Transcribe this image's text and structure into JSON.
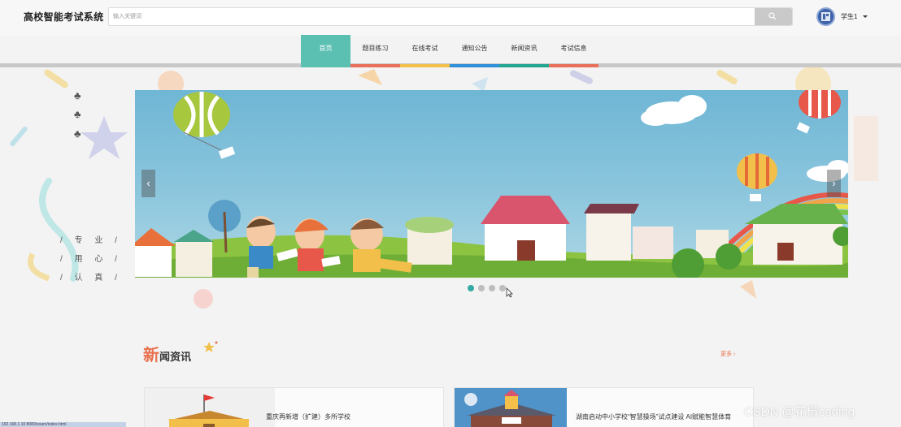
{
  "app": {
    "title": "高校智能考试系统"
  },
  "search": {
    "placeholder": "输入关键词",
    "value": ""
  },
  "user": {
    "name": "学生1"
  },
  "nav": {
    "items": [
      {
        "label": "首页",
        "color": "#5bbfb2",
        "active": true
      },
      {
        "label": "题目练习",
        "color": "#e8705a",
        "active": false
      },
      {
        "label": "在线考试",
        "color": "#f2c04a",
        "active": false
      },
      {
        "label": "通知公告",
        "color": "#2f8fd8",
        "active": false
      },
      {
        "label": "新闻资讯",
        "color": "#22a590",
        "active": false
      },
      {
        "label": "考试信息",
        "color": "#e8705a",
        "active": false
      }
    ]
  },
  "side_motto": [
    "/ 专 业 /",
    "/ 用 心 /",
    "/ 认 真 /"
  ],
  "carousel": {
    "prev_label": "‹",
    "next_label": "›",
    "slide_count": 4,
    "active_index": 0
  },
  "news_section": {
    "title_big": "新",
    "title_rest": "闻资讯",
    "more_label": "更多 ›",
    "cards": [
      {
        "title": "重庆再新增（扩建）多所学校",
        "thumb_icon": "school-flag-icon"
      },
      {
        "title": "湖南启动中小学校“智慧操场”试点建设 AI赋能智慧体育",
        "thumb_icon": "school-building-icon"
      }
    ]
  },
  "watermark": "CSDN @花椒coding",
  "status_bar": "192.168.1.10:8080/exam/index.html",
  "colors": {
    "accent": "#5bbfb2",
    "news_red": "#e8704d"
  }
}
